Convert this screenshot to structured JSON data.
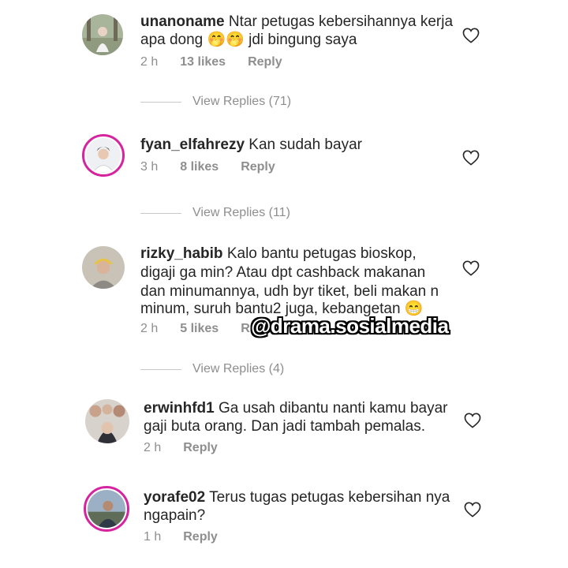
{
  "comments": [
    {
      "username": "unanoname",
      "text": "Ntar petugas kebersihannya kerja apa dong",
      "text_line1": "Ntar petugas kebersihannya kerja",
      "text_line2": "apa dong 🤭🤭 jdi bingung saya",
      "time": "2 h",
      "likes": "13 likes",
      "reply": "Reply",
      "view_replies": "View Replies (71)"
    },
    {
      "username": "fyan_elfahrezy",
      "text_line1": "Kan sudah bayar",
      "time": "3 h",
      "likes": "8 likes",
      "reply": "Reply",
      "view_replies": "View Replies (11)"
    },
    {
      "username": "rizky_habib",
      "text_line1": "Kalo bantu petugas bioskop,",
      "text_line2": "digaji ga min? Atau dpt cashback makanan",
      "text_line3": "dan minumannya, udh byr tiket, beli makan n",
      "text_line4": "minum, suruh bantu2 juga, kebangetan 😁",
      "time": "2 h",
      "likes": "5 likes",
      "reply": "R",
      "view_replies": "View Replies (4)"
    },
    {
      "username": "erwinhfd1",
      "text_line1": "Ga usah dibantu nanti kamu bayar",
      "text_line2": "gaji buta orang. Dan jadi tambah pemalas.",
      "time": "2 h",
      "reply": "Reply"
    },
    {
      "username": "yorafe02",
      "text_line1": "Terus tugas petugas kebersihan nya",
      "text_line2": "ngapain?",
      "time": "1 h",
      "reply": "Reply"
    }
  ],
  "watermark": "@drama.sosialmedia",
  "icons": {
    "heart": "heart-outline-icon",
    "avatar_ring": "#d6249f"
  }
}
